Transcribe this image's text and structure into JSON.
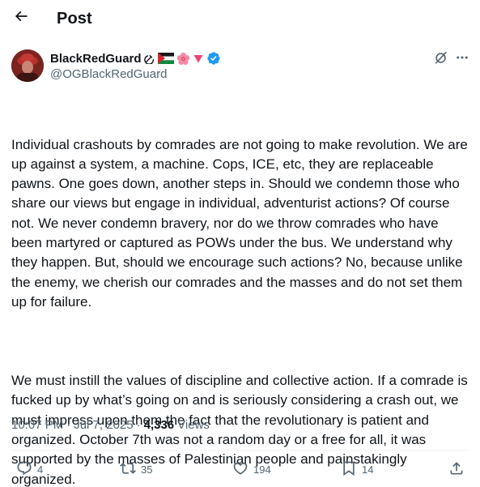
{
  "header": {
    "back_icon": "arrow-left-icon",
    "title": "Post"
  },
  "author": {
    "display_name": "BlackRedGuard",
    "handle": "@OGBlackRedGuard",
    "badges": [
      "hammer-sickle-emoji",
      "palestine-flag-emoji",
      "hibiscus-emoji",
      "red-triangle-emoji",
      "verified-badge-icon"
    ],
    "verified_color": "#1d9bf0"
  },
  "tweet": {
    "paragraphs": [
      "Individual crashouts by comrades are not going to make revolution. We are up against a system, a machine. Cops, ICE, etc, they are replaceable pawns. One goes down, another steps in. Should we condemn those who share our views but engage in individual, adventurist actions? Of course not. We never condemn bravery, nor do we throw comrades who have been martyred or captured as POWs under the bus. We understand why they happen. But, should we encourage such actions? No, because unlike the enemy, we cherish our comrades and the masses and do not set them up for failure.",
      "We must instill the values of discipline and collective action. If a comrade is fucked up by what’s going on and is seriously considering a crash out, we must impress upon them the fact that the revolutionary is patient and organized. October 7th was not a random day or a free for all, it was supported by the masses of Palestinian people and painstakingly organized."
    ]
  },
  "meta": {
    "time": "10:07 PM",
    "separator": "·",
    "date": "Jul 7, 2025",
    "views_count": "4,336",
    "views_label": "Views"
  },
  "actions": {
    "replies": "4",
    "reposts": "35",
    "likes": "194",
    "bookmarks": "14"
  },
  "colors": {
    "text_primary": "#0f1419",
    "text_secondary": "#536471",
    "divider": "#eff3f4"
  }
}
